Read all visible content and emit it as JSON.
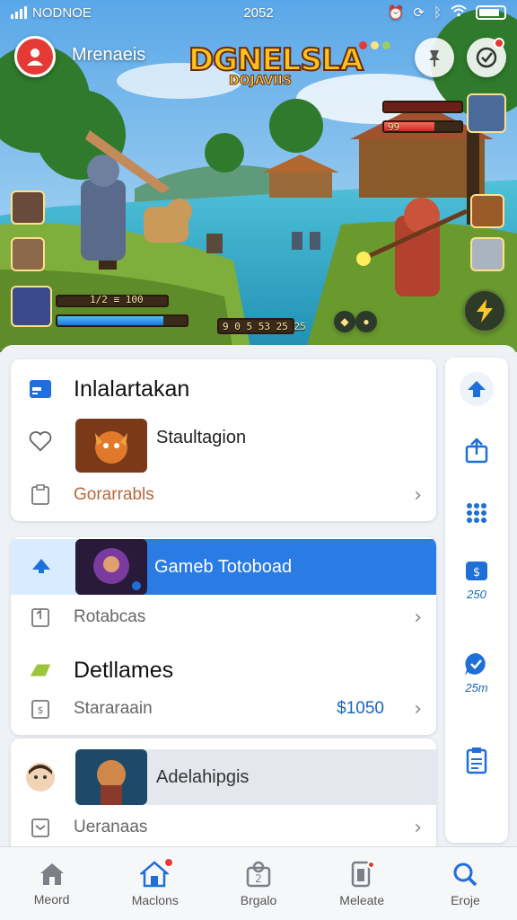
{
  "status": {
    "carrier": "NODNOE",
    "time": "2052"
  },
  "header": {
    "app_name": "Mrenaeis",
    "logo_line1": "DGNELSLA",
    "logo_line2": "DOJAVIIS"
  },
  "hud": {
    "player_label": "1/2 ≡ 100",
    "timer": "9 0 5 53 25 25",
    "top_label": "99"
  },
  "card1": {
    "title": "Inlalartakan",
    "item_label": "Staultagion",
    "link_label": "Gorarrabls"
  },
  "card2": {
    "highlight_label": "Gameb Totoboad",
    "row1_label": "Rotabcas",
    "section_title": "Detllames",
    "row2_label": "Stararaain",
    "row2_value": "$1050"
  },
  "card3": {
    "item_label": "Adelahipgis",
    "row_label": "Ueranaas"
  },
  "rail": {
    "item4_label": "250",
    "item5_label": "25m"
  },
  "bottomnav": {
    "items": [
      {
        "label": "Meord",
        "icon": "home-icon"
      },
      {
        "label": "Maclons",
        "icon": "home-active-icon"
      },
      {
        "label": "Brgalo",
        "icon": "puzzle-icon"
      },
      {
        "label": "Meleate",
        "icon": "phone-icon"
      },
      {
        "label": "Eroje",
        "icon": "search-icon"
      }
    ]
  },
  "colors": {
    "accent": "#1e6fd9",
    "highlight_bar": "#2a7be4",
    "price": "#1565c0",
    "link": "#b8673a"
  }
}
